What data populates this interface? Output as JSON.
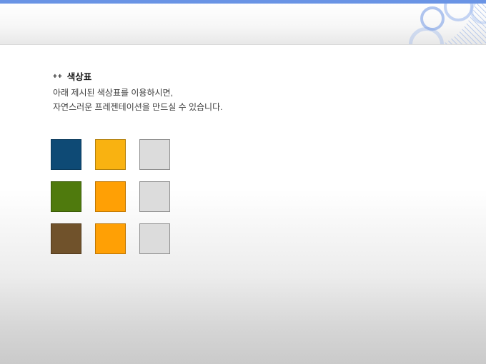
{
  "slide": {
    "title": {
      "prefix": "++",
      "text": "색상표"
    },
    "body_lines": [
      "아래 제시된 색상표를 이용하시면,",
      "자연스러운 프레젠테이션을 만드실 수 있습니다."
    ],
    "palette": {
      "rows": 3,
      "cols": 3,
      "cells": [
        {
          "name": "dark-navy",
          "hex": "#0E4A75",
          "border": "#0A3A5C"
        },
        {
          "name": "amber",
          "hex": "#F9B211",
          "border": "#B5810C"
        },
        {
          "name": "light-gray",
          "hex": "#DCDCDC",
          "border": "#8F8F8F"
        },
        {
          "name": "olive-green",
          "hex": "#4F7A0D",
          "border": "#3A5A08"
        },
        {
          "name": "orange",
          "hex": "#FFA005",
          "border": "#BF7703"
        },
        {
          "name": "light-gray",
          "hex": "#DCDCDC",
          "border": "#8F8F8F"
        },
        {
          "name": "brown",
          "hex": "#70522B",
          "border": "#523B1E"
        },
        {
          "name": "orange",
          "hex": "#FFA005",
          "border": "#BF7703"
        },
        {
          "name": "light-gray",
          "hex": "#DCDCDC",
          "border": "#8F8F8F"
        }
      ]
    },
    "theme": {
      "top_bar_blue": "#6A94E5",
      "decoration_blue": "#A8C0EC",
      "page_bottom_gray": "#CACACA"
    }
  }
}
